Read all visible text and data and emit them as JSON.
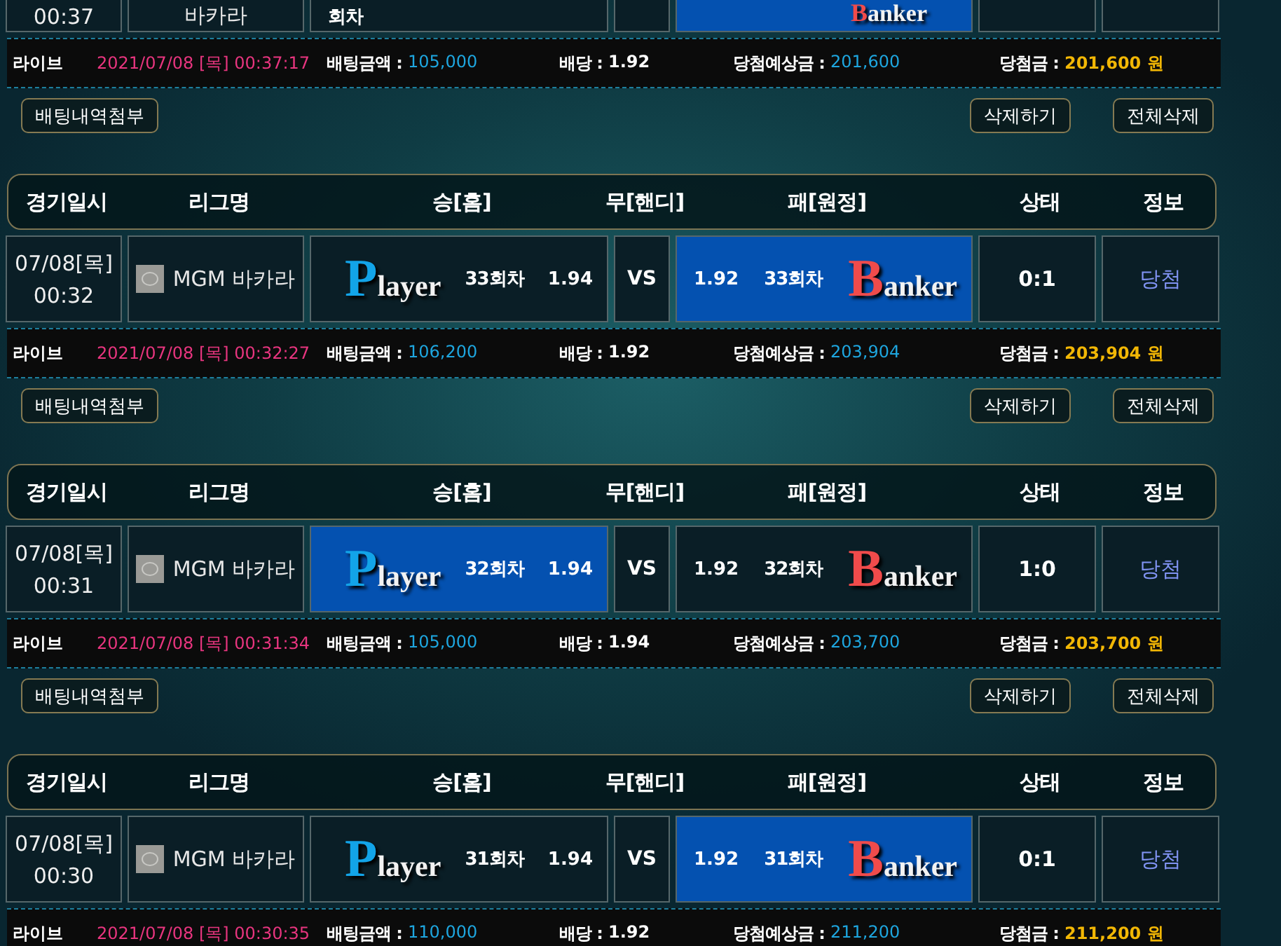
{
  "bets": [
    {
      "game": {
        "time": "00:37",
        "league": "바카라",
        "player": {
          "round": "회차",
          "selected": false
        },
        "banker": {
          "logo": "Banker",
          "selected": true
        }
      },
      "info": {
        "type": "라이브",
        "time": "2021/07/08 [목] 00:37:17",
        "fields": [
          {
            "label": "배팅금액 :",
            "value": "105,000",
            "kind": "amount"
          },
          {
            "label": "배당 :",
            "value": "1.92",
            "kind": "odds"
          },
          {
            "label": "당첨예상금 :",
            "value": "201,600",
            "kind": "amount"
          },
          {
            "label": "당첨금 :",
            "value": "201,600 원",
            "kind": "payout"
          }
        ]
      },
      "buttons": [
        "배팅내역첨부",
        "삭제하기",
        "전체삭제"
      ]
    },
    {
      "header": [
        "경기일시",
        "리그명",
        "승[홈]",
        "무[핸디]",
        "패[원정]",
        "상태",
        "정보"
      ],
      "game": {
        "date": "07/08[목]",
        "time": "00:32",
        "league": "MGM 바카라",
        "league_icon": true,
        "player": {
          "logo": "Player",
          "round": "33회차",
          "odds": "1.94",
          "selected": false
        },
        "vs": "VS",
        "banker": {
          "logo": "Banker",
          "round": "33회차",
          "odds": "1.92",
          "selected": true
        },
        "status": "0:1",
        "result": "당첨"
      },
      "info": {
        "type": "라이브",
        "time": "2021/07/08 [목] 00:32:27",
        "fields": [
          {
            "label": "배팅금액 :",
            "value": "106,200",
            "kind": "amount"
          },
          {
            "label": "배당 :",
            "value": "1.92",
            "kind": "odds"
          },
          {
            "label": "당첨예상금 :",
            "value": "203,904",
            "kind": "amount"
          },
          {
            "label": "당첨금 :",
            "value": "203,904 원",
            "kind": "payout"
          }
        ]
      },
      "buttons": [
        "배팅내역첨부",
        "삭제하기",
        "전체삭제"
      ]
    },
    {
      "header": [
        "경기일시",
        "리그명",
        "승[홈]",
        "무[핸디]",
        "패[원정]",
        "상태",
        "정보"
      ],
      "game": {
        "date": "07/08[목]",
        "time": "00:31",
        "league": "MGM 바카라",
        "league_icon": true,
        "player": {
          "logo": "Player",
          "round": "32회차",
          "odds": "1.94",
          "selected": true
        },
        "vs": "VS",
        "banker": {
          "logo": "Banker",
          "round": "32회차",
          "odds": "1.92",
          "selected": false
        },
        "status": "1:0",
        "result": "당첨"
      },
      "info": {
        "type": "라이브",
        "time": "2021/07/08 [목] 00:31:34",
        "fields": [
          {
            "label": "배팅금액 :",
            "value": "105,000",
            "kind": "amount"
          },
          {
            "label": "배당 :",
            "value": "1.94",
            "kind": "odds"
          },
          {
            "label": "당첨예상금 :",
            "value": "203,700",
            "kind": "amount"
          },
          {
            "label": "당첨금 :",
            "value": "203,700 원",
            "kind": "payout"
          }
        ]
      },
      "buttons": [
        "배팅내역첨부",
        "삭제하기",
        "전체삭제"
      ]
    },
    {
      "header": [
        "경기일시",
        "리그명",
        "승[홈]",
        "무[핸디]",
        "패[원정]",
        "상태",
        "정보"
      ],
      "game": {
        "date": "07/08[목]",
        "time": "00:30",
        "league": "MGM 바카라",
        "league_icon": true,
        "player": {
          "logo": "Player",
          "round": "31회차",
          "odds": "1.94",
          "selected": false
        },
        "vs": "VS",
        "banker": {
          "logo": "Banker",
          "round": "31회차",
          "odds": "1.92",
          "selected": true
        },
        "status": "0:1",
        "result": "당첨"
      },
      "info": {
        "type": "라이브",
        "time": "2021/07/08 [목] 00:30:35",
        "fields": [
          {
            "label": "배팅금액 :",
            "value": "110,000",
            "kind": "amount"
          },
          {
            "label": "배당 :",
            "value": "1.92",
            "kind": "odds"
          },
          {
            "label": "당첨예상금 :",
            "value": "211,200",
            "kind": "amount"
          },
          {
            "label": "당첨금 :",
            "value": "211,200 원",
            "kind": "payout"
          }
        ]
      }
    }
  ]
}
